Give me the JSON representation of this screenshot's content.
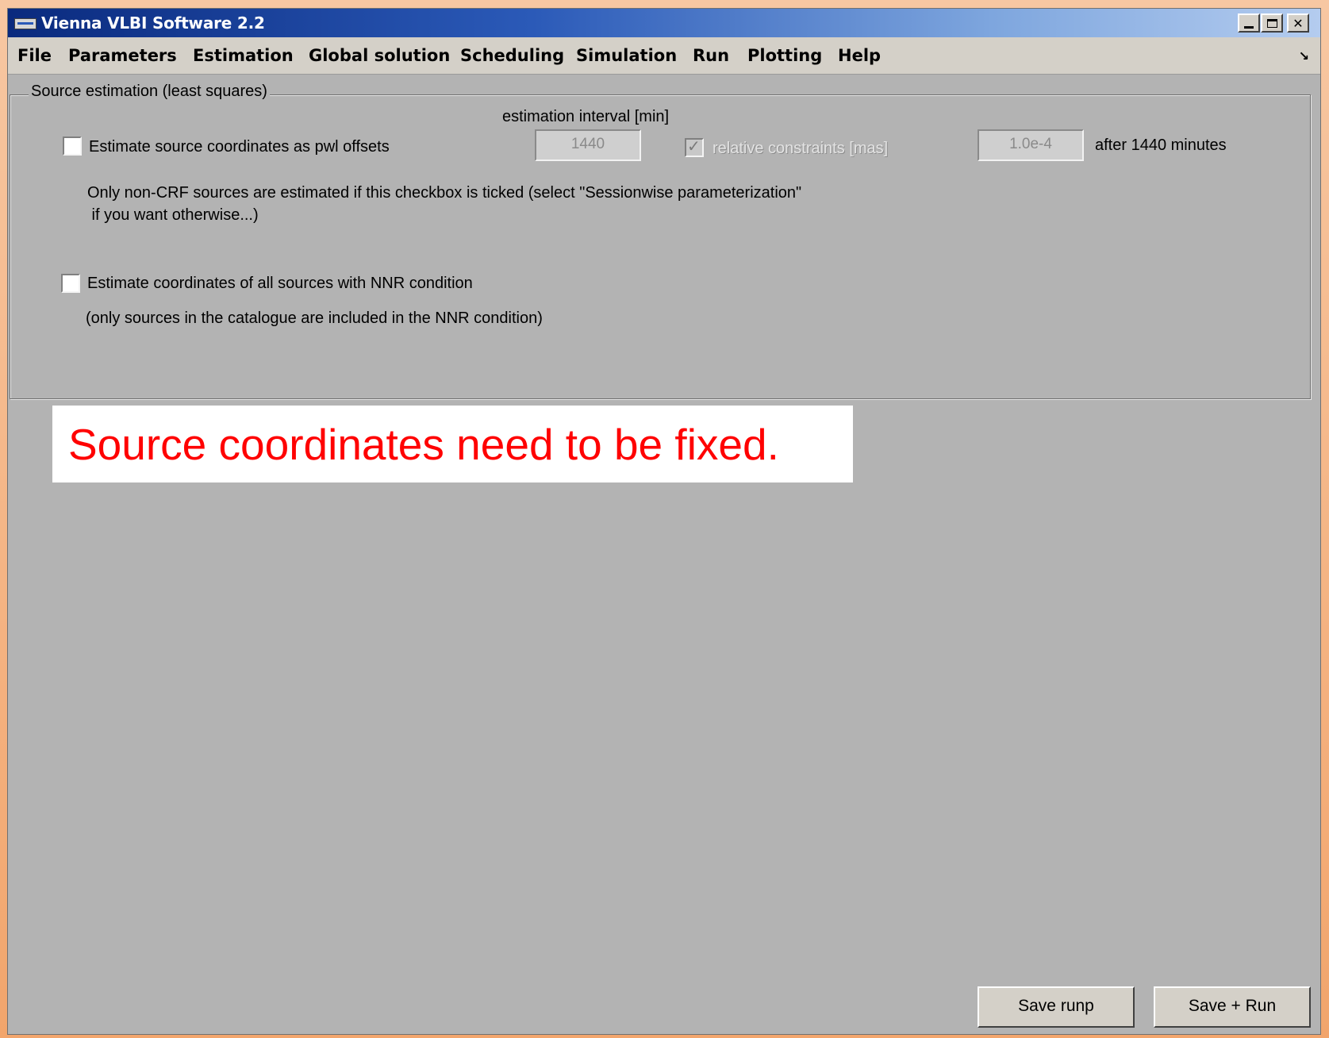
{
  "window": {
    "title": "Vienna VLBI Software 2.2"
  },
  "menubar": {
    "items": [
      "File",
      "Parameters",
      "Estimation",
      "Global solution",
      "Scheduling",
      "Simulation",
      "Run",
      "Plotting",
      "Help"
    ],
    "dock_icon": "↘"
  },
  "panel": {
    "legend": "Source estimation (least squares)",
    "interval_header": "estimation interval [min]",
    "pwl_checkbox_label": "Estimate source coordinates as pwl offsets",
    "pwl_checked": false,
    "interval_value": "1440",
    "rel_constraints_label": "relative constraints [mas]",
    "rel_constraints_checked": true,
    "rel_constraints_value": "1.0e-4",
    "after_label": "after 1440 minutes",
    "info_line1": "Only non-CRF sources are estimated if this checkbox is ticked (select \"Sessionwise parameterization\"",
    "info_line2": " if you want otherwise...)",
    "nnr_checkbox_label": "Estimate coordinates of all sources with NNR condition",
    "nnr_checked": false,
    "nnr_info": "(only sources in the catalogue are included in the NNR condition)"
  },
  "annotation": {
    "text": "Source coordinates need to be fixed.",
    "color": "#ff0000"
  },
  "buttons": {
    "save_runp": "Save runp",
    "save_run": "Save + Run"
  },
  "colors": {
    "window_bg": "#b3b3b3",
    "titlebar_start": "#0a2a7e",
    "titlebar_end": "#b4ccef",
    "menubar_bg": "#d4d0c8"
  }
}
